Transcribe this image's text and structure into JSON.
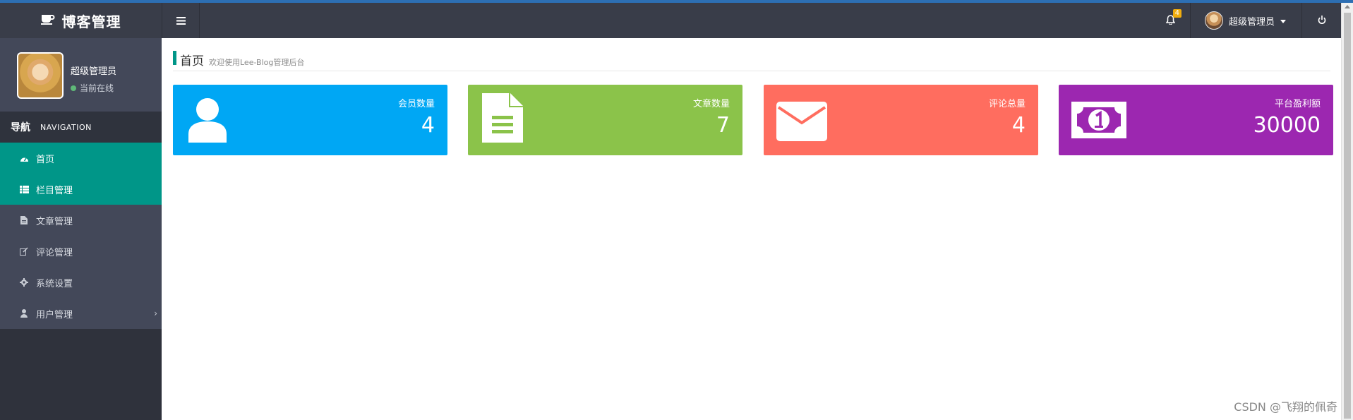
{
  "header": {
    "brand_title": "博客管理",
    "notification_count": "4",
    "user_name": "超级管理员"
  },
  "sidebar": {
    "profile": {
      "name": "超级管理员",
      "status": "当前在线"
    },
    "nav_heading": {
      "cn": "导航",
      "en": "NAVIGATION"
    },
    "items": [
      {
        "label": "首页",
        "icon": "dashboard-icon"
      },
      {
        "label": "栏目管理",
        "icon": "list-icon"
      },
      {
        "label": "文章管理",
        "icon": "file-icon"
      },
      {
        "label": "评论管理",
        "icon": "edit-icon"
      },
      {
        "label": "系统设置",
        "icon": "gear-icon"
      },
      {
        "label": "用户管理",
        "icon": "user-icon"
      }
    ]
  },
  "main": {
    "page_title": "首页",
    "page_subtitle": "欢迎使用Lee-Blog管理后台",
    "cards": [
      {
        "label": "会员数量",
        "value": "4",
        "icon": "user-icon",
        "color": "#00a7f4"
      },
      {
        "label": "文章数量",
        "value": "7",
        "icon": "document-icon",
        "color": "#8bc34a"
      },
      {
        "label": "评论总量",
        "value": "4",
        "icon": "envelope-icon",
        "color": "#ff6d5f"
      },
      {
        "label": "平台盈利额",
        "value": "30000",
        "icon": "money-icon",
        "color": "#9c27b0"
      }
    ]
  },
  "watermark": "CSDN @飞翔的佩奇",
  "colors": {
    "header_bg": "#393d49",
    "sidebar_bg": "#2f323c",
    "accent": "#009688"
  }
}
